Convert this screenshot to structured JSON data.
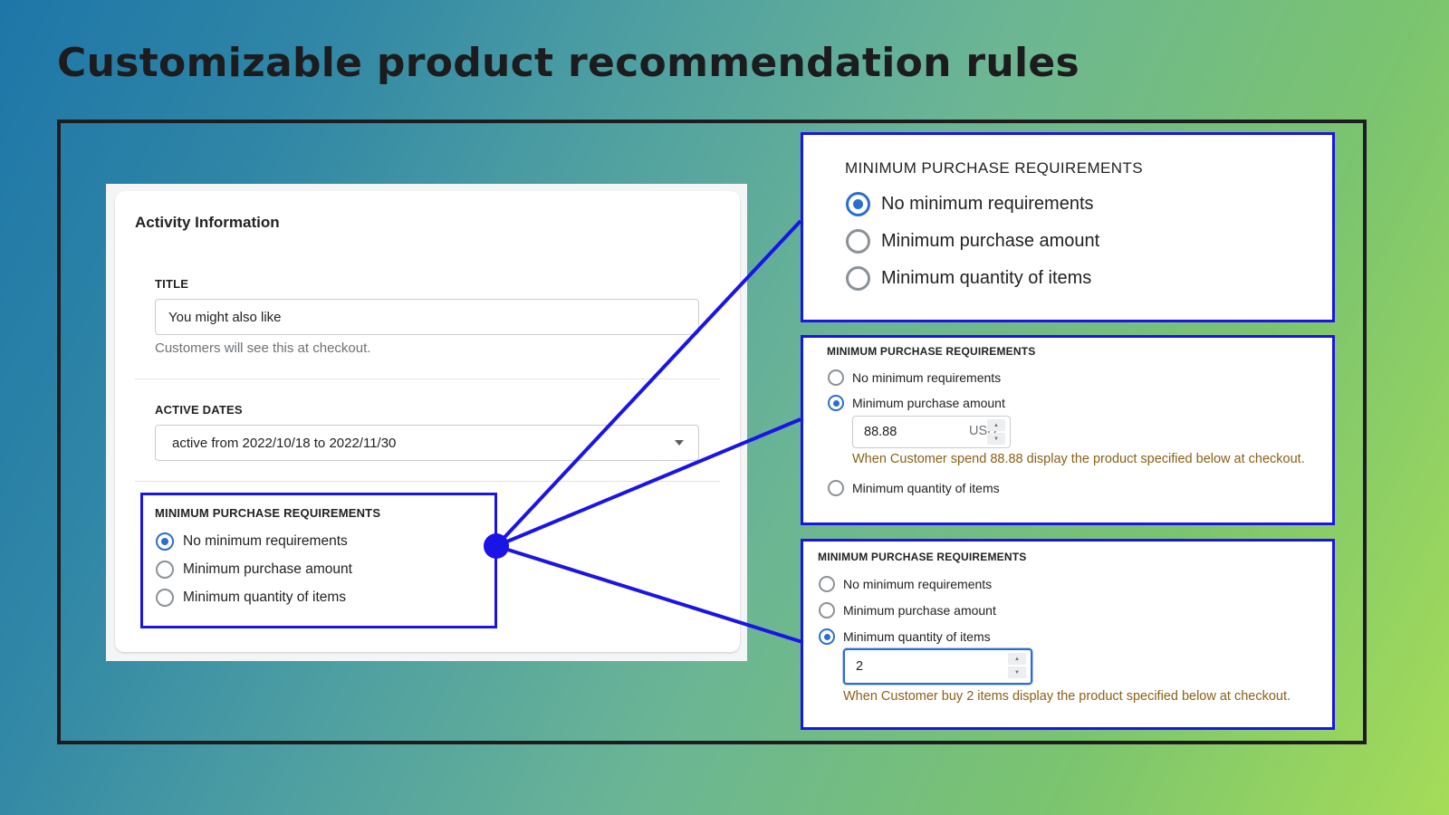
{
  "hero": {
    "title": "Customizable product recommendation rules"
  },
  "form": {
    "card_title": "Activity Information",
    "title_field": {
      "label": "TITLE",
      "value": "You might also like",
      "help": "Customers will see this at checkout."
    },
    "active_dates": {
      "label": "ACTIVE DATES",
      "selected": "active from 2022/10/18 to 2022/11/30"
    },
    "requirements": {
      "label": "MINIMUM PURCHASE REQUIREMENTS",
      "options": [
        {
          "label": "No minimum requirements",
          "checked": true
        },
        {
          "label": "Minimum purchase amount",
          "checked": false
        },
        {
          "label": "Minimum quantity of items",
          "checked": false
        }
      ]
    }
  },
  "panels": [
    {
      "label": "MINIMUM PURCHASE REQUIREMENTS",
      "options": [
        {
          "label": "No minimum requirements",
          "checked": true
        },
        {
          "label": "Minimum purchase amount",
          "checked": false
        },
        {
          "label": "Minimum quantity of items",
          "checked": false
        }
      ]
    },
    {
      "label": "MINIMUM PURCHASE REQUIREMENTS",
      "options": [
        {
          "label": "No minimum requirements",
          "checked": false
        },
        {
          "label": "Minimum purchase amount",
          "checked": true
        },
        {
          "label": "Minimum quantity of items",
          "checked": false
        }
      ],
      "amount_value": "88.88",
      "amount_suffix": "USD",
      "hint": "When Customer spend 88.88 display the product specified below at checkout."
    },
    {
      "label": "MINIMUM PURCHASE REQUIREMENTS",
      "options": [
        {
          "label": "No minimum requirements",
          "checked": false
        },
        {
          "label": "Minimum purchase amount",
          "checked": false
        },
        {
          "label": "Minimum quantity of items",
          "checked": true
        }
      ],
      "quantity_value": "2",
      "hint": "When Customer buy 2 items display the product specified below at checkout."
    }
  ],
  "colors": {
    "connector": "#1a14e6",
    "accent": "#2c6ecb",
    "hint_text": "#8a6116"
  }
}
